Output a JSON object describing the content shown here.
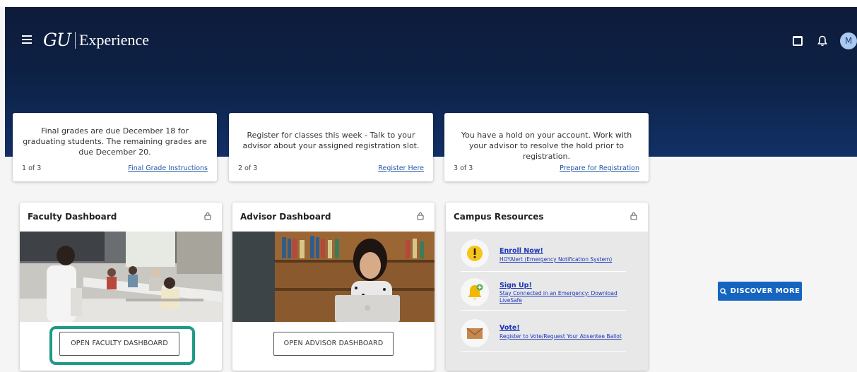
{
  "header": {
    "logo_mark": "GU",
    "logo_text": "Experience",
    "avatar_initial": "M"
  },
  "notices": [
    {
      "message": "Final grades are due December 18 for graduating students. The remaining grades are due December 20.",
      "count": "1 of 3",
      "link": "Final Grade Instructions"
    },
    {
      "message": "Register for classes this week - Talk to your advisor about your assigned registration slot.",
      "count": "2 of 3",
      "link": "Register Here"
    },
    {
      "message": "You have a hold on your account. Work with your advisor to resolve the hold prior to registration.",
      "count": "3 of 3",
      "link": "Prepare for Registration"
    }
  ],
  "cards": {
    "faculty": {
      "title": "Faculty Dashboard",
      "button": "OPEN FACULTY DASHBOARD"
    },
    "advisor": {
      "title": "Advisor Dashboard",
      "button": "OPEN ADVISOR DASHBOARD"
    },
    "resources": {
      "title": "Campus Resources",
      "items": [
        {
          "icon": "exclamation-icon",
          "title": "Enroll Now!",
          "desc": "HOYAlert (Emergency Notification System)"
        },
        {
          "icon": "bell-plus-icon",
          "title": "Sign Up!",
          "desc": "Stay Connected in an Emergency: Download LiveSafe"
        },
        {
          "icon": "envelope-icon",
          "title": "Vote!",
          "desc": "Register to Vote/Request Your Absentee Ballot"
        }
      ]
    }
  },
  "discover": {
    "label": "DISCOVER MORE",
    "icon": "search-icon"
  },
  "colors": {
    "hero": "#0d2145",
    "accent": "#1565c0",
    "highlight": "#1f9a85",
    "link": "#1d36b5"
  }
}
